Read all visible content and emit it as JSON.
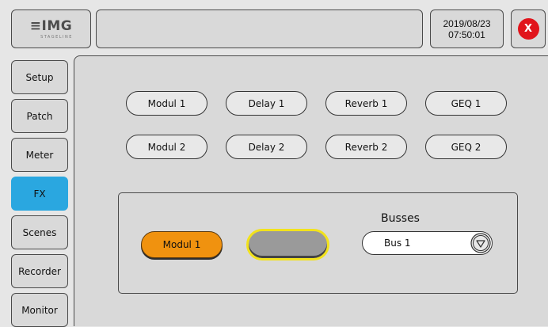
{
  "header": {
    "logo_main": "≡IMG",
    "logo_sub": "STAGELINE",
    "title": "",
    "date": "2019/08/23",
    "time": "07:50:01",
    "close_label": "X"
  },
  "sidebar": {
    "items": [
      {
        "label": "Setup"
      },
      {
        "label": "Patch"
      },
      {
        "label": "Meter"
      },
      {
        "label": "FX",
        "active": true
      },
      {
        "label": "Scenes"
      },
      {
        "label": "Recorder"
      },
      {
        "label": "Monitor"
      }
    ]
  },
  "fx_modules": {
    "row1": [
      "Modul 1",
      "Delay 1",
      "Reverb 1",
      "GEQ 1"
    ],
    "row2": [
      "Modul 2",
      "Delay 2",
      "Reverb 2",
      "GEQ 2"
    ]
  },
  "assignment": {
    "selected_module": "Modul 1",
    "target_slot": "",
    "busses_label": "Busses",
    "bus_value": "Bus 1"
  },
  "colors": {
    "active_nav": "#2aa7e0",
    "selected_module": "#f0920f",
    "target_highlight": "#f2e21c",
    "close_button": "#e1141b"
  }
}
